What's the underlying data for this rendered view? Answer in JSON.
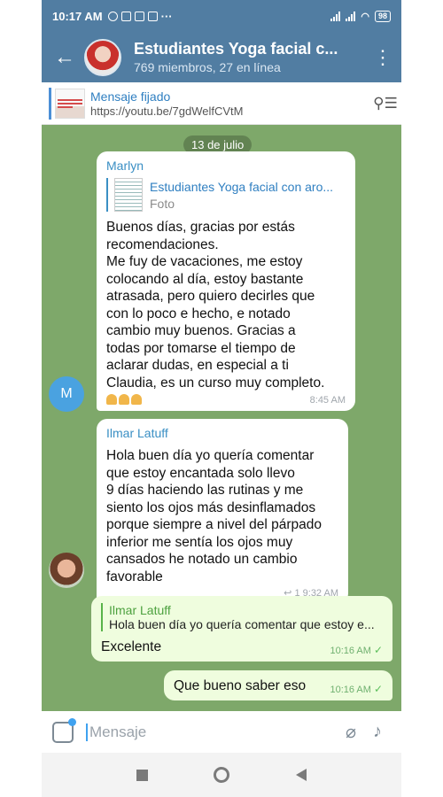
{
  "status_bar": {
    "time": "10:17 AM",
    "battery": "98",
    "more": "···"
  },
  "header": {
    "title": "Estudiantes Yoga facial c...",
    "subtitle": "769 miembros, 27 en línea"
  },
  "pinned": {
    "title": "Mensaje fijado",
    "link": "https://youtu.be/7gdWelfCVtM"
  },
  "date_label": "13 de julio",
  "messages": [
    {
      "sender": "Marlyn",
      "reply_title": "Estudiantes Yoga facial con aro...",
      "reply_subtitle": "Foto",
      "text": "Buenos días, gracias por estás\nrecomendaciones.\nMe fuy de vacaciones, me estoy\ncolocando al día, estoy bastante\natrasada, pero quiero decirles que\ncon lo poco e hecho, e notado\ncambio muy buenos. Gracias a\ntodas por tomarse el tiempo de\naclarar dudas, en especial a ti\nClaudia, es un curso muy completo.",
      "time": "8:45 AM",
      "avatar_letter": "M"
    },
    {
      "sender": "Ilmar Latuff",
      "text": "Hola buen día yo quería comentar\nque estoy encantada solo llevo\n9 días haciendo las rutinas y me\nsiento los ojos más desinflamados\nporque siempre a nivel del párpado\ninferior me sentía los ojos muy\ncansados he notado un cambio\nfavorable",
      "replies_count": "1",
      "time": "9:32 AM"
    },
    {
      "reply_sender": "Ilmar Latuff",
      "reply_text": "Hola buen día yo quería comentar que estoy e...",
      "text": "Excelente",
      "time": "10:16 AM"
    },
    {
      "text": "Que bueno saber eso",
      "time": "10:16 AM"
    }
  ],
  "input": {
    "placeholder": "Mensaje"
  },
  "colors": {
    "header": "#517da2",
    "chat_bg": "#7ea86a",
    "outgoing": "#effdde",
    "accent": "#3a8fc4"
  },
  "icons": [
    "back-arrow-icon",
    "more-vert-icon",
    "unpin-icon",
    "sticker-icon",
    "attach-icon",
    "mic-icon",
    "check-icon",
    "reply-icon"
  ]
}
